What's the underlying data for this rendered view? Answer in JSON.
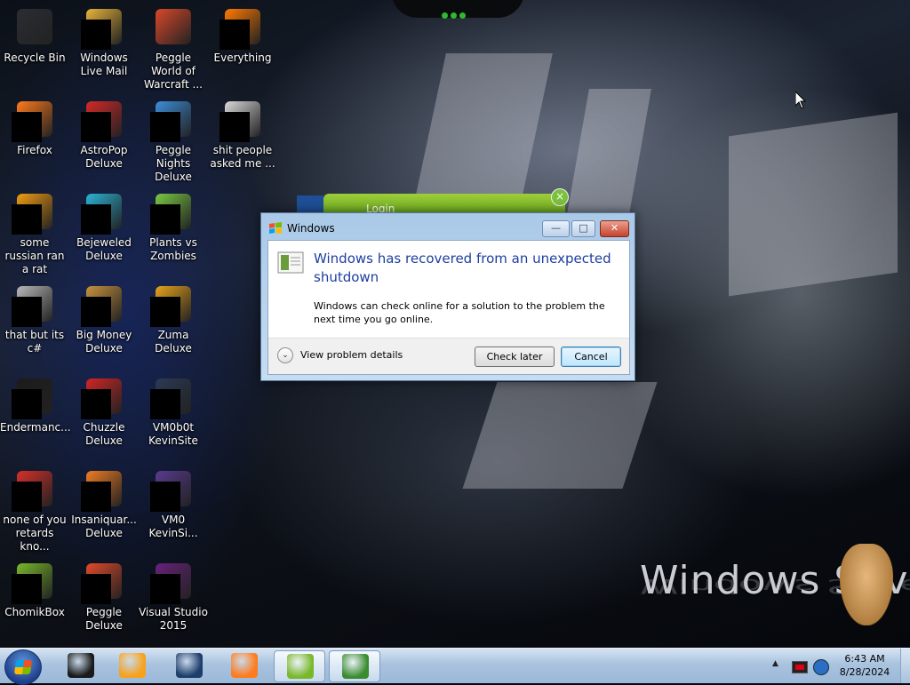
{
  "wallpaper": {
    "brand_text": "Windows Seven"
  },
  "desktop_icons": [
    {
      "label": "Recycle Bin",
      "color": "#2a2d33",
      "masked": false
    },
    {
      "label": "Firefox",
      "color": "#ff7b1c",
      "masked": true
    },
    {
      "label": "some russian ran a rat",
      "color": "#f39c12",
      "masked": true
    },
    {
      "label": "that but its c#",
      "color": "#b8b8b8",
      "masked": true
    },
    {
      "label": "Endermanc...",
      "color": "#1b1b1b",
      "masked": true
    },
    {
      "label": "none of you retards kno...",
      "color": "#d9302a",
      "masked": true
    },
    {
      "label": "ChomikBox",
      "color": "#79b82a",
      "masked": true
    },
    {
      "label": "Windows Live Mail",
      "color": "#e8b43a",
      "masked": true
    },
    {
      "label": "AstroPop Deluxe",
      "color": "#d62828",
      "masked": true
    },
    {
      "label": "Bejeweled Deluxe",
      "color": "#2bb3d6",
      "masked": true
    },
    {
      "label": "Big Money Deluxe",
      "color": "#c7923e",
      "masked": true
    },
    {
      "label": "Chuzzle Deluxe",
      "color": "#d32525",
      "masked": true
    },
    {
      "label": "Insaniquar... Deluxe",
      "color": "#f07d22",
      "masked": true
    },
    {
      "label": "Peggle Deluxe",
      "color": "#e24a2a",
      "masked": true
    },
    {
      "label": "Peggle World of Warcraft ...",
      "color": "#d9482a",
      "masked": false
    },
    {
      "label": "Peggle Nights Deluxe",
      "color": "#3c8ed9",
      "masked": true
    },
    {
      "label": "Plants vs Zombies",
      "color": "#7ac943",
      "masked": true
    },
    {
      "label": "Zuma Deluxe",
      "color": "#e7a21a",
      "masked": true
    },
    {
      "label": "VM0b0t KevinSite",
      "color": "#2b3a55",
      "masked": true
    },
    {
      "label": "VM0 KevinSi...",
      "color": "#5a3a90",
      "masked": true
    },
    {
      "label": "Visual Studio 2015",
      "color": "#68217a",
      "masked": true
    },
    {
      "label": "Everything",
      "color": "#ff7a00",
      "masked": true
    },
    {
      "label": "shit people asked me ...",
      "color": "#d9d9d9",
      "masked": true
    }
  ],
  "login_gadget": {
    "title": "Login",
    "close_symbol": "×"
  },
  "dialog": {
    "title": "Windows",
    "minimize_symbol": "—",
    "maximize_symbol": "□",
    "close_symbol": "✕",
    "heading": "Windows has recovered from an unexpected shutdown",
    "message": "Windows can check online for a solution to the problem the next time you go online.",
    "details_label": "View problem details",
    "details_symbol": "⌄",
    "check_later_label": "Check later",
    "cancel_label": "Cancel"
  },
  "taskbar": {
    "items": [
      {
        "name": "media-box",
        "color": "#1a1a1a"
      },
      {
        "name": "media-player",
        "color": "#f7a21b"
      },
      {
        "name": "globe",
        "color": "#1d3d6b"
      },
      {
        "name": "firefox",
        "color": "#ff7b1c"
      },
      {
        "name": "chomikbox",
        "color": "#79b82a"
      },
      {
        "name": "checklist-app",
        "color": "#3a8c2f"
      }
    ],
    "tray_arrow": "▲",
    "clock_time": "6:43 AM",
    "clock_date": "8/28/2024"
  }
}
